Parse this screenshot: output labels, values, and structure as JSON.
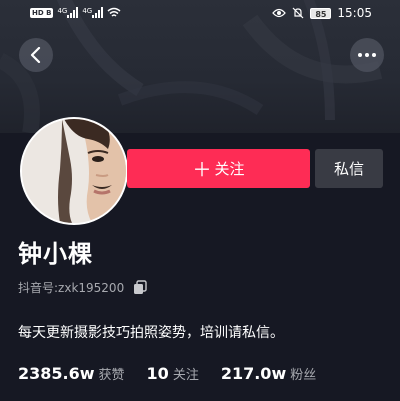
{
  "status_bar": {
    "hd_badge": "HD B",
    "signal_1_label": "4G",
    "signal_2_label": "4G",
    "battery": "85",
    "time": "15:05"
  },
  "profile": {
    "nickname": "钟小棵",
    "id_label": "抖音号: ",
    "id_value": "zxk195200",
    "bio": "每天更新摄影技巧拍照姿势，培训请私信。"
  },
  "actions": {
    "follow_plus": "＋",
    "follow_label": "关注",
    "message_label": "私信"
  },
  "stats": {
    "likes_value": "2385.6w",
    "likes_label": "获赞",
    "following_value": "10",
    "following_label": "关注",
    "followers_value": "217.0w",
    "followers_label": "粉丝"
  },
  "colors": {
    "background": "#161823",
    "follow_button": "#fe2c55",
    "message_button": "#393b44",
    "secondary_text": "#a7a9af"
  },
  "icons": [
    "back-arrow-icon",
    "more-dots-icon",
    "copy-icon",
    "eye-icon",
    "mute-bell-icon",
    "wifi-icon",
    "signal-icon",
    "battery-icon"
  ]
}
